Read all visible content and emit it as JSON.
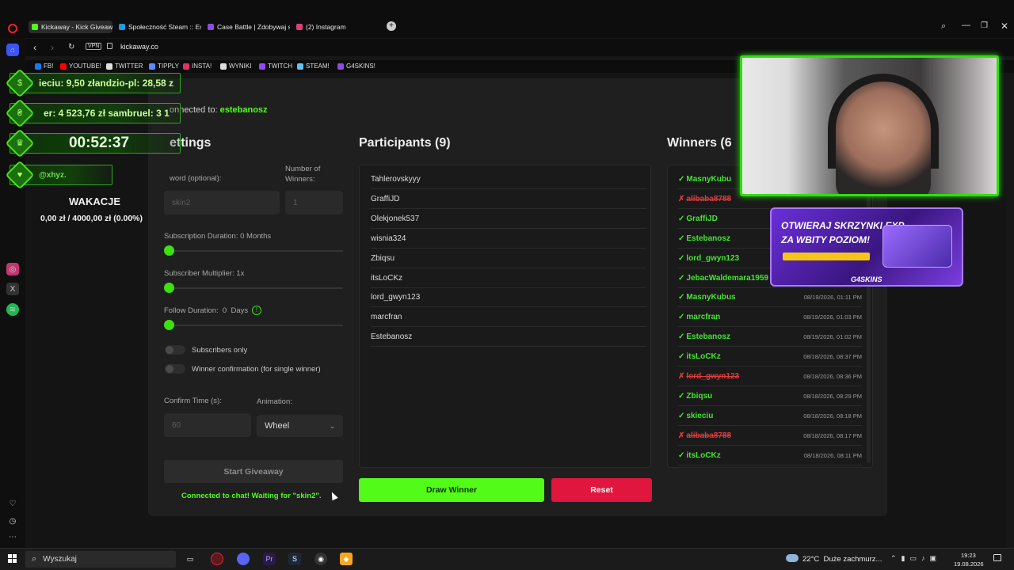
{
  "browser": {
    "tabs": [
      {
        "label": "Kickaway - Kick Giveaway",
        "color": "#53fc18",
        "active": true
      },
      {
        "label": "Społeczność Steam :: Este",
        "color": "#1b9be0",
        "active": false
      },
      {
        "label": "Case Battle | Zdobywaj sk",
        "color": "#8a4de0",
        "active": false
      },
      {
        "label": "(2) Instagram",
        "color": "#e0407a",
        "active": false
      }
    ],
    "url": "kickaway.co",
    "vpn_label": "VPN",
    "bookmarks": [
      {
        "label": "FB!",
        "color": "#1877f2"
      },
      {
        "label": "YOUTUBE!",
        "color": "#ff0000"
      },
      {
        "label": "TWITTER",
        "color": "#e0e0e0"
      },
      {
        "label": "TIPPLY",
        "color": "#5b8cff"
      },
      {
        "label": "INSTA!",
        "color": "#e1306c"
      },
      {
        "label": "WYNIKI",
        "color": "#dddddd"
      },
      {
        "label": "TWITCH",
        "color": "#9146ff"
      },
      {
        "label": "STEAM!",
        "color": "#66c0f4"
      },
      {
        "label": "G4SKINS!",
        "color": "#8a4de0"
      }
    ]
  },
  "app": {
    "connected_prefix": "onnected to:",
    "connected_channel": "estebanosz",
    "settings": {
      "title": "ettings",
      "keyword_label": "word (optional):",
      "keyword_placeholder": "skin2",
      "winners_label": "Number of Winners:",
      "winners_placeholder": "1",
      "subscription_label": "Subscription Duration: 0 Months",
      "multiplier_label": "Subscriber Multiplier: 1x",
      "follow_label": "Follow Duration:  0  Days",
      "subscribers_only_label": "Subscribers only",
      "winner_confirmation_label": "Winner confirmation (for single winner)",
      "confirm_time_label": "Confirm Time (s):",
      "confirm_time_placeholder": "60",
      "animation_label": "Animation:",
      "animation_value": "Wheel",
      "start_button": "Start Giveaway",
      "status_message": "Connected to chat! Waiting for \"skin2\"."
    },
    "participants": {
      "title": "Participants (9)",
      "items": [
        "Tahlerovskyyy",
        "GraffiJD",
        "Olekjonek537",
        "wisnia324",
        "Zbiqsu",
        "itsLoCKz",
        "lord_gwyn123",
        "marcfran",
        "Estebanosz"
      ]
    },
    "winners": {
      "title": "Winners (6",
      "items": [
        {
          "name": "MasnyKubu",
          "status": "ok",
          "date": ""
        },
        {
          "name": "alibaba8788",
          "status": "bad",
          "date": ""
        },
        {
          "name": "GraffiJD",
          "status": "ok",
          "date": ""
        },
        {
          "name": "Estebanosz",
          "status": "ok",
          "date": ""
        },
        {
          "name": "lord_gwyn123",
          "status": "ok",
          "date": ""
        },
        {
          "name": "JebacWaldemara1959",
          "status": "ok",
          "date": ""
        },
        {
          "name": "MasnyKubus",
          "status": "ok",
          "date": "08/19/2026, 01:11 PM"
        },
        {
          "name": "marcfran",
          "status": "ok",
          "date": "08/19/2026, 01:03 PM"
        },
        {
          "name": "Estebanosz",
          "status": "ok",
          "date": "08/19/2026, 01:02 PM"
        },
        {
          "name": "itsLoCKz",
          "status": "ok",
          "date": "08/18/2026, 08:37 PM"
        },
        {
          "name": "lord_gwyn123",
          "status": "bad",
          "date": "08/18/2026, 08:36 PM"
        },
        {
          "name": "Zbiqsu",
          "status": "ok",
          "date": "08/18/2026, 08:29 PM"
        },
        {
          "name": "skieciu",
          "status": "ok",
          "date": "08/18/2026, 08:18 PM"
        },
        {
          "name": "alibaba8788",
          "status": "bad",
          "date": "08/18/2026, 08:17 PM"
        },
        {
          "name": "itsLoCKz",
          "status": "ok",
          "date": "08/18/2026, 08:11 PM"
        }
      ]
    },
    "draw_button": "Draw Winner",
    "reset_button": "Reset",
    "colors": {
      "accent_green": "#53fc18",
      "reset_red": "#e0163e"
    }
  },
  "overlay": {
    "ticker1": "ieciu: 9,50 złandzio-pl: 28,58 z",
    "ticker2": "er: 4 523,76 zł sambruel: 3 1",
    "timer": "00:52:37",
    "handle": "@xhyz.",
    "goal_title": "WAKACJE",
    "goal_value": "0,00 zł / 4000,00 zł (0.00%)",
    "promo_line1": "OTWIERAJ SKRZYNKI EXP",
    "promo_line2": "ZA WBITY POZIOM!",
    "promo_brand": "G4SKINS"
  },
  "taskbar": {
    "search_placeholder": "Wyszukaj",
    "weather": "22°C  Duże zachmurz...",
    "time": "19:23",
    "date": "19.08.2026"
  }
}
